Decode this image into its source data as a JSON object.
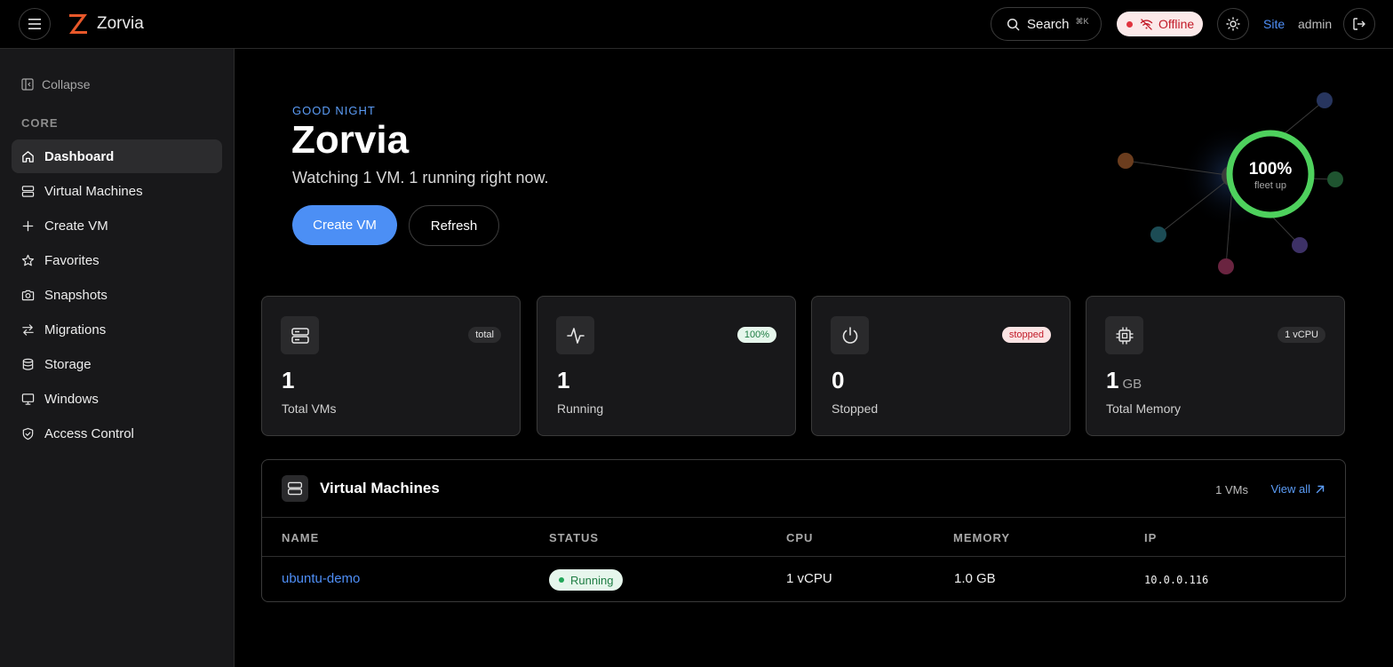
{
  "app": {
    "name": "Zorvia"
  },
  "topbar": {
    "search_label": "Search",
    "search_shortcut": "⌘K",
    "status_label": "Offline",
    "site_link": "Site",
    "user": "admin"
  },
  "sidebar": {
    "collapse_label": "Collapse",
    "section": "CORE",
    "items": [
      {
        "label": "Dashboard",
        "icon": "home-icon",
        "active": true
      },
      {
        "label": "Virtual Machines",
        "icon": "server-icon"
      },
      {
        "label": "Create VM",
        "icon": "plus-icon"
      },
      {
        "label": "Favorites",
        "icon": "star-icon"
      },
      {
        "label": "Snapshots",
        "icon": "camera-icon"
      },
      {
        "label": "Migrations",
        "icon": "arrows-icon"
      },
      {
        "label": "Storage",
        "icon": "database-icon"
      },
      {
        "label": "Windows",
        "icon": "monitor-icon"
      },
      {
        "label": "Access Control",
        "icon": "shield-icon"
      }
    ]
  },
  "hero": {
    "greeting": "GOOD NIGHT",
    "title": "Zorvia",
    "subtitle": "Watching 1 VM. 1 running right now.",
    "primary_button": "Create VM",
    "secondary_button": "Refresh",
    "fleet_percent": "100%",
    "fleet_label": "fleet up",
    "fleet_up_fraction": 1.0
  },
  "stats": [
    {
      "icon": "server-icon",
      "badge": "total",
      "value": "1",
      "unit": "",
      "label": "Total VMs"
    },
    {
      "icon": "activity-icon",
      "badge": "100%",
      "value": "1",
      "unit": "",
      "label": "Running"
    },
    {
      "icon": "power-icon",
      "badge": "stopped",
      "value": "0",
      "unit": "",
      "label": "Stopped"
    },
    {
      "icon": "cpu-icon",
      "badge": "1 vCPU",
      "value": "1",
      "unit": "GB",
      "label": "Total Memory"
    }
  ],
  "vm_table": {
    "title": "Virtual Machines",
    "count": "1 VMs",
    "view_all": "View all",
    "columns": [
      "NAME",
      "STATUS",
      "CPU",
      "MEMORY",
      "IP"
    ],
    "rows": [
      {
        "name": "ubuntu-demo",
        "status": "Running",
        "cpu": "1 vCPU",
        "memory": "1.0 GB",
        "ip": "10.0.0.116"
      }
    ]
  },
  "colors": {
    "accent": "#4c8ff5",
    "running": "#22a559",
    "offline": "#e0343f",
    "brand": "#e8582a"
  }
}
